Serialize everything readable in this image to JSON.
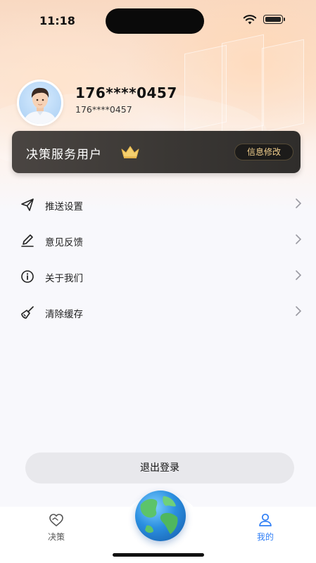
{
  "status_bar": {
    "time": "11:18"
  },
  "profile": {
    "name": "176****0457",
    "subtitle": "176****0457"
  },
  "member_card": {
    "title": "决策服务用户",
    "edit_label": "信息修改"
  },
  "menu": {
    "items": [
      {
        "label": "推送设置",
        "icon": "send-icon"
      },
      {
        "label": "意见反馈",
        "icon": "pen-icon"
      },
      {
        "label": "关于我们",
        "icon": "info-icon"
      },
      {
        "label": "清除缓存",
        "icon": "broom-icon"
      }
    ]
  },
  "logout_label": "退出登录",
  "tabs": [
    {
      "label": "决策",
      "icon": "handshake-icon",
      "active": false
    },
    {
      "label": "我的",
      "icon": "person-icon",
      "active": true
    }
  ],
  "colors": {
    "active_tab": "#2f7ef5",
    "inactive_tab": "#555555",
    "gold": "#f2cf8c"
  }
}
